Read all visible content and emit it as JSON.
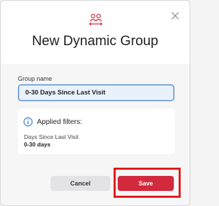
{
  "dialog": {
    "title": "New Dynamic Group",
    "icon": "group-icon",
    "close_icon": "close-icon"
  },
  "form": {
    "group_name_label": "Group name",
    "group_name_value": "0-30 Days Since Last Visit"
  },
  "filters": {
    "icon": "info-icon",
    "heading": "Applied filters:",
    "items": [
      {
        "name": "Days Since Last Visit",
        "value": "0-30 days"
      }
    ]
  },
  "actions": {
    "cancel_label": "Cancel",
    "save_label": "Save",
    "save_highlighted": true
  },
  "colors": {
    "accent": "#d22a3d",
    "input_border": "#7da7d9",
    "info": "#2f7fd0",
    "highlight": "#e01818"
  }
}
